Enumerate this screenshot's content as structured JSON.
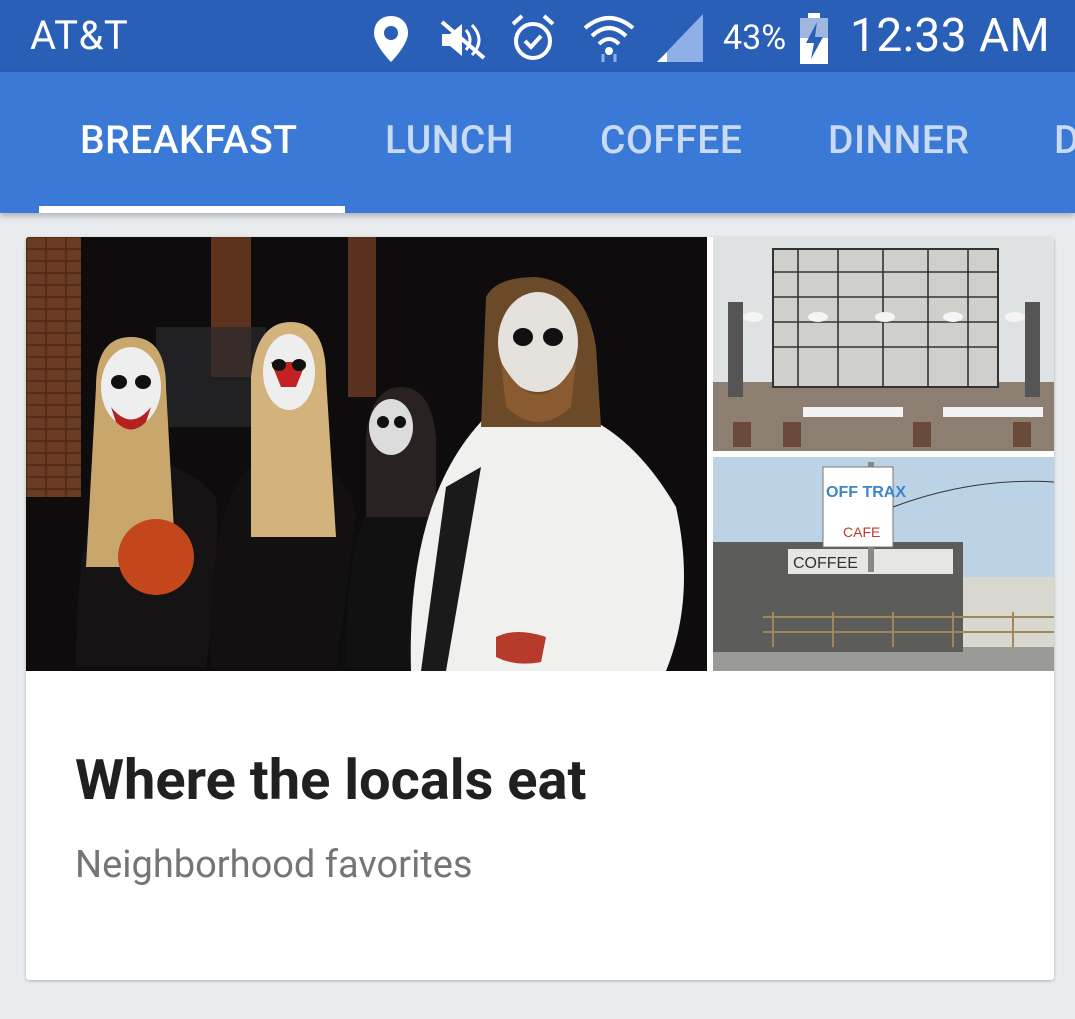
{
  "status_bar": {
    "carrier": "AT&T",
    "battery_percent": "43%",
    "time": "12:33 AM",
    "icons": [
      "location-icon",
      "mute-icon",
      "alarm-icon",
      "wifi-icon",
      "signal-icon",
      "battery-charging-icon"
    ]
  },
  "tabs": [
    {
      "label": "BREAKFAST",
      "active": true
    },
    {
      "label": "LUNCH",
      "active": false
    },
    {
      "label": "COFFEE",
      "active": false
    },
    {
      "label": "DINNER",
      "active": false
    },
    {
      "label": "D",
      "active": false
    }
  ],
  "card": {
    "title": "Where the locals eat",
    "subtitle": "Neighborhood favorites",
    "images": {
      "bottom_sign_text": "OFF TRAX",
      "bottom_sign_sub": "CAFE",
      "bottom_building_text": "COFFEE"
    }
  },
  "colors": {
    "status_bar": "#2a5fb8",
    "tab_bar": "#3a79d6",
    "background": "#e9ecee"
  }
}
